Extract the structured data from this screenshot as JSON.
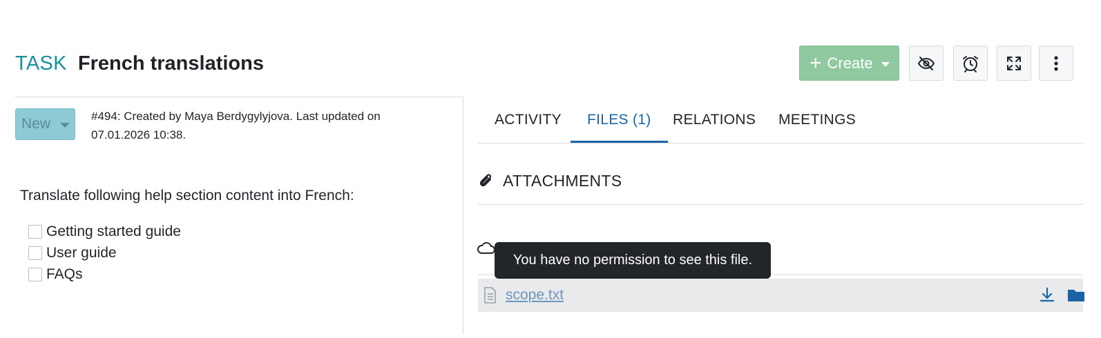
{
  "header": {
    "type_label": "TASK",
    "subject": "French translations",
    "create_label": "Create"
  },
  "status": {
    "label": "New"
  },
  "meta_text": "#494: Created by Maya Berdygylyjova. Last updated on 07.01.2026 10:38.",
  "description": {
    "intro": "Translate following help section content into French:",
    "items": [
      "Getting started guide",
      "User guide",
      "FAQs"
    ]
  },
  "tabs": [
    "ACTIVITY",
    "FILES (1)",
    "RELATIONS",
    "MEETINGS"
  ],
  "active_tab": "FILES (1)",
  "attachments": {
    "title": "ATTACHMENTS",
    "files": [
      "scope.txt"
    ]
  },
  "tooltip": "You have no permission to see this file.",
  "colors": {
    "type_accent": "#1a8f9e",
    "create_button": "#90c8a0",
    "status_button": "#8ccad6",
    "tab_active": "#1a63a6",
    "tooltip_bg": "#22262a"
  },
  "icons": [
    "plus-icon",
    "caret-down-icon",
    "eye-slash-icon",
    "alarm-clock-icon",
    "expand-icon",
    "more-vertical-icon",
    "paperclip-icon",
    "cloud-icon",
    "file-text-icon",
    "download-icon",
    "folder-icon"
  ]
}
